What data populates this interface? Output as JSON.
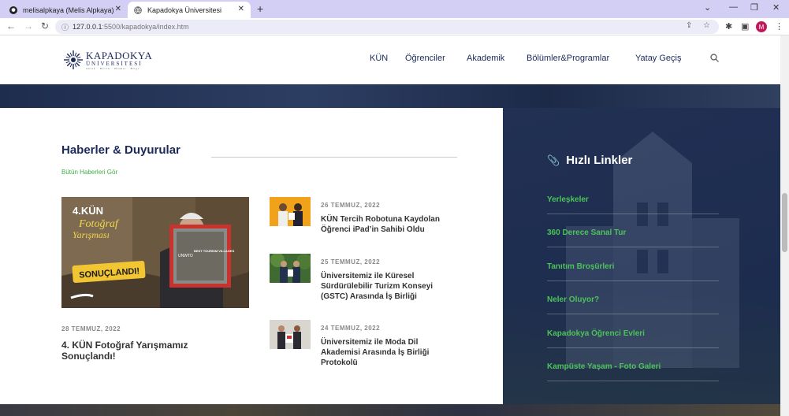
{
  "browser": {
    "tabs": [
      {
        "title": "melisalpkaya (Melis Alpkaya)",
        "icon": "github-icon"
      },
      {
        "title": "Kapadokya Üniversitesi",
        "icon": "globe-icon"
      }
    ],
    "url_host": "127.0.0.1",
    "url_path": ":5500/kapadokya/index.htm",
    "profile_initial": "M"
  },
  "site": {
    "logo": {
      "line1": "KAPADOKYA",
      "line2": "ÜNİVERSİTESİ",
      "line3": "Ahlak · Birlik · Hizmet · Bilgi"
    },
    "menu": [
      "KÜN",
      "Öğrenciler",
      "Akademik",
      "Bölümler&Programlar",
      "Yatay Geçiş"
    ]
  },
  "news": {
    "title": "Haberler & Duyurular",
    "all_link": "Bütün Haberleri Gör",
    "featured": {
      "date": "28 TEMMUZ, 2022",
      "title": "4. KÜN Fotoğraf Yarışmamız Sonuçlandı!",
      "image_text": {
        "top1": "4.KÜN",
        "top2": "Fotoğraf",
        "top3": "Yarışması",
        "badge": "SONUÇLANDI!",
        "frame": "BEST TOURISM VILLAGES",
        "org": "UNWTO"
      }
    },
    "items": [
      {
        "date": "26 TEMMUZ, 2022",
        "title": "KÜN Tercih Robotuna Kaydolan Öğrenci iPad’in Sahibi Oldu"
      },
      {
        "date": "25 TEMMUZ, 2022",
        "title": "Üniversitemiz ile Küresel Sürdürülebilir Turizm Konseyi (GSTC) Arasında İş Birliği"
      },
      {
        "date": "24 TEMMUZ, 2022",
        "title": "Üniversitemiz ile Moda Dil Akademisi Arasında İş Birliği Protokolü"
      }
    ]
  },
  "quick_links": {
    "title": "Hızlı Linkler",
    "items": [
      "Yerleşkeler",
      "360 Derece Sanal Tur",
      "Tanıtım Broşürleri",
      "Neler Oluyor?",
      "Kapadokya Öğrenci Evleri",
      "Kampüste Yaşam - Foto Galeri"
    ]
  },
  "colors": {
    "brand_navy": "#1b2a5a",
    "accent_green": "#4cc35a",
    "tab_strip": "#d3cff4"
  }
}
